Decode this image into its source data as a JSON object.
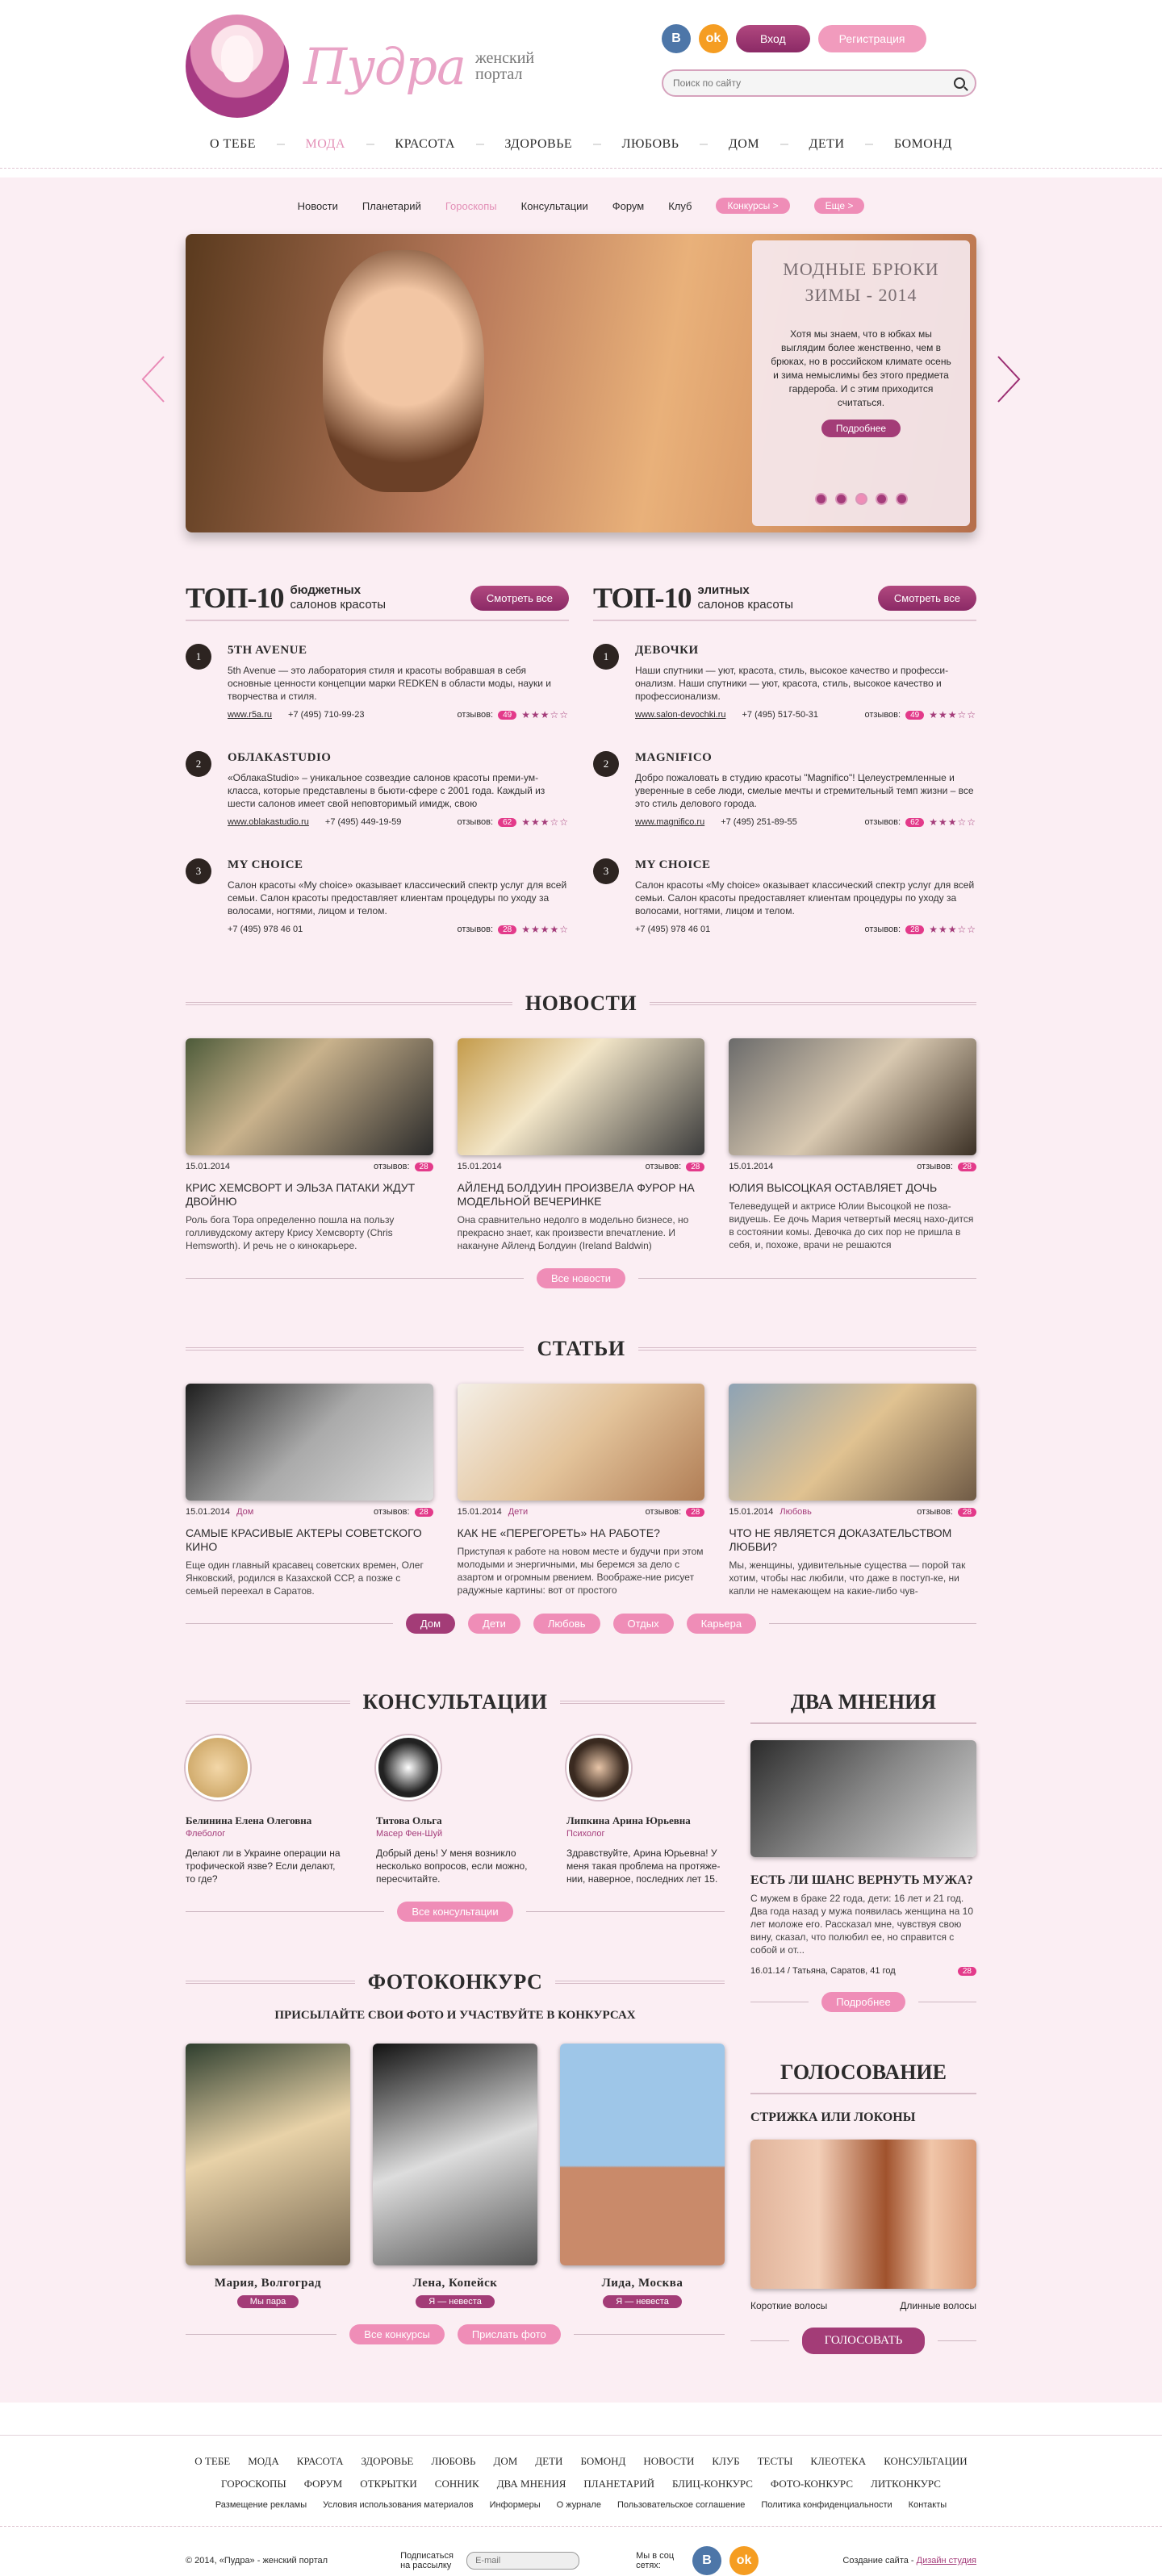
{
  "header": {
    "logo_word": "Пудра",
    "logo_sub1": "женский",
    "logo_sub2": "портал",
    "vk": "B",
    "ok": "ok",
    "login": "Вход",
    "register": "Регистрация",
    "search_placeholder": "Поиск по сайту"
  },
  "main_nav": [
    "О ТЕБЕ",
    "МОДА",
    "КРАСОТА",
    "ЗДОРОВЬЕ",
    "ЛЮБОВЬ",
    "ДОМ",
    "ДЕТИ",
    "БОМОНД"
  ],
  "main_nav_active": 1,
  "sub_nav": [
    "Новости",
    "Планетарий",
    "Гороскопы",
    "Консультации",
    "Форум",
    "Клуб"
  ],
  "sub_nav_active": 2,
  "sub_nav_pills": [
    "Конкурсы >",
    "Еще >"
  ],
  "slider": {
    "title": "МОДНЫЕ БРЮКИ ЗИМЫ - 2014",
    "text": "Хотя мы знаем, что в юбках мы выглядим более женственно, чем в брюках, но в российском климате осень и зима немыслимы без этого предмета гардероба. И с этим приходится считаться.",
    "button": "Подробнее",
    "dots": 5,
    "active_dot": 2
  },
  "top10": [
    {
      "title": "ТОП-10",
      "sub_bold": "бюджетных",
      "sub": "салонов красоты",
      "button": "Смотреть все",
      "items": [
        {
          "n": "1",
          "name": "5TH AVENUE",
          "desc": "5th Avenue — это лаборатория стиля и красоты вобравшая в себя основные ценности концепции марки REDKEN в области моды, науки и творчества и стиля.",
          "url": "www.r5a.ru",
          "phone": "+7 (495) 710-99-23",
          "reviews_label": "отзывов:",
          "reviews": "49",
          "stars": "★★★☆☆"
        },
        {
          "n": "2",
          "name": "ОБЛАКАSTUDIO",
          "desc": "«ОблакаStudio» – уникальное созвездие салонов красоты преми-ум-класса, которые представлены в бьюти-сфере с 2001 года. Каждый из шести салонов имеет свой неповторимый имидж, свою",
          "url": "www.oblakastudio.ru",
          "phone": "+7 (495) 449-19-59",
          "reviews_label": "отзывов:",
          "reviews": "62",
          "stars": "★★★☆☆"
        },
        {
          "n": "3",
          "name": "MY CHOICE",
          "desc": "Салон красоты «My choice» оказывает классический спектр услуг для всей семьи. Салон красоты предоставляет клиентам процедуры по уходу за волосами, ногтями, лицом и телом.",
          "url": "",
          "phone": "+7 (495) 978 46 01",
          "reviews_label": "отзывов:",
          "reviews": "28",
          "stars": "★★★★☆"
        }
      ]
    },
    {
      "title": "ТОП-10",
      "sub_bold": "элитных",
      "sub": "салонов красоты",
      "button": "Смотреть все",
      "items": [
        {
          "n": "1",
          "name": "ДЕВОЧКИ",
          "desc": "Наши спутники — уют, красота, стиль, высокое качество и професси-онализм. Наши спутники — уют, красота, стиль, высокое качество и профессионализм.",
          "url": "www.salon-devochki.ru",
          "phone": "+7 (495) 517-50-31",
          "reviews_label": "отзывов:",
          "reviews": "49",
          "stars": "★★★☆☆"
        },
        {
          "n": "2",
          "name": "MAGNIFICO",
          "desc": "Добро пожаловать в студию красоты \"Magnifico\"! Целеустремленные и уверенные в себе люди, смелые мечты и стремительный темп жизни – все это стиль делового города.",
          "url": "www.magnifico.ru",
          "phone": "+7 (495) 251-89-55",
          "reviews_label": "отзывов:",
          "reviews": "62",
          "stars": "★★★☆☆"
        },
        {
          "n": "3",
          "name": "MY CHOICE",
          "desc": "Салон красоты «My choice» оказывает классический спектр услуг для всей семьи. Салон красоты предоставляет клиентам процедуры по уходу за волосами, ногтями, лицом и телом.",
          "url": "",
          "phone": "+7 (495) 978 46 01",
          "reviews_label": "отзывов:",
          "reviews": "28",
          "stars": "★★★☆☆"
        }
      ]
    }
  ],
  "news": {
    "title": "НОВОСТИ",
    "more": "Все новости",
    "items": [
      {
        "date": "15.01.2014",
        "reviews_label": "отзывов:",
        "reviews": "28",
        "title": "КРИС ХЕМСВОРТ И ЭЛЬЗА ПАТАКИ ЖДУТ ДВОЙНЮ",
        "text": "Роль бога Тора определенно пошла на пользу голливудскому актеру Крису Хемсворту (Chris Hemsworth). И речь не о кинокарьере."
      },
      {
        "date": "15.01.2014",
        "reviews_label": "отзывов:",
        "reviews": "28",
        "title": "АЙЛЕНД БОЛДУИН ПРОИЗВЕЛА ФУРОР НА МОДЕЛЬНОЙ ВЕЧЕРИНКЕ",
        "text": "Она сравнительно недолго в модельно бизнесе, но прекрасно знает, как произвести впечатление. И накануне Айленд Болдуин (Ireland Baldwin)"
      },
      {
        "date": "15.01.2014",
        "reviews_label": "отзывов:",
        "reviews": "28",
        "title": "ЮЛИЯ ВЫСОЦКАЯ ОСТАВЛЯЕТ ДОЧЬ",
        "text": "Телеведущей и актрисе Юлии Высоцкой не поза-видуешь. Ее дочь Мария четвертый месяц нахо-дится в состоянии комы. Девочка до сих пор не пришла в себя, и, похоже, врачи не решаются"
      }
    ]
  },
  "articles": {
    "title": "СТАТЬИ",
    "tabs": [
      "Дом",
      "Дети",
      "Любовь",
      "Отдых",
      "Карьера"
    ],
    "tab_active": 0,
    "items": [
      {
        "date": "15.01.2014",
        "cat": "Дом",
        "reviews_label": "отзывов:",
        "reviews": "28",
        "title": "САМЫЕ КРАСИВЫЕ АКТЕРЫ СОВЕТСКОГО КИНО",
        "text": "Еще один главный красавец советских времен, Олег Янковский, родился в Казахской ССР, а позже с семьей переехал в Саратов."
      },
      {
        "date": "15.01.2014",
        "cat": "Дети",
        "reviews_label": "отзывов:",
        "reviews": "28",
        "title": "КАК НЕ «ПЕРЕГОРЕТЬ» НА РАБОТЕ?",
        "text": "Приступая к работе на новом месте и будучи при этом молодыми и энергичными, мы беремся за дело с азартом и огромным рвением. Воображе-ние рисует радужные картины: вот от простого"
      },
      {
        "date": "15.01.2014",
        "cat": "Любовь",
        "reviews_label": "отзывов:",
        "reviews": "28",
        "title": "ЧТО НЕ ЯВЛЯЕТСЯ ДОКАЗАТЕЛЬСТВОМ ЛЮБВИ?",
        "text": "Мы, женщины, удивительные существа — порой так хотим, чтобы нас любили, что даже в поступ-ке, ни капли не намекающем на какие-либо чув-"
      }
    ]
  },
  "consults": {
    "title": "КОНСУЛЬТАЦИИ",
    "more": "Все консультации",
    "items": [
      {
        "name": "Белинина Елена Олеговна",
        "role": "Флеболог",
        "text": "Делают ли в Украине операции на трофической язве? Если делают, то где?"
      },
      {
        "name": "Титова Ольга",
        "role": "Масер Фен-Шуй",
        "text": "Добрый день! У меня возникло несколько вопросов, если можно, пересчитайте."
      },
      {
        "name": "Липкина Арина Юрьевна",
        "role": "Психолог",
        "text": "Здравствуйте, Арина Юрьевна! У меня такая проблема на протяже-нии, наверное, последних лет 15."
      }
    ]
  },
  "contest": {
    "title": "ФОТОКОНКУРС",
    "subtitle": "ПРИСЫЛАЙТЕ СВОИ ФОТО И УЧАСТВУЙТЕ В КОНКУРСАХ",
    "items": [
      {
        "name": "Мария, Волгоград",
        "tag": "Мы пара"
      },
      {
        "name": "Лена, Копейск",
        "tag": "Я — невеста"
      },
      {
        "name": "Лида, Москва",
        "tag": "Я — невеста"
      }
    ],
    "btn_all": "Все конкурсы",
    "btn_send": "Прислать фото"
  },
  "opinions": {
    "title": "ДВА МНЕНИЯ",
    "question": "ЕСТЬ ЛИ ШАНС ВЕРНУТЬ МУЖА?",
    "text": "С мужем в браке 22 года, дети: 16 лет и 21 год. Два года назад у мужа появилась женщина на 10 лет моложе его. Рассказал мне, чувствуя свою вину, сказал, что полюбил ее, но справится с собой и от...",
    "meta": "16.01.14 / Татьяна, Саратов, 41 год",
    "reviews": "28",
    "button": "Подробнее"
  },
  "vote": {
    "title": "ГОЛОСОВАНИЕ",
    "question": "СТРИЖКА ИЛИ ЛОКОНЫ",
    "opt1": "Короткие волосы",
    "opt2": "Длинные волосы",
    "button": "ГОЛОСОВАТЬ"
  },
  "footer": {
    "nav1": [
      "О ТЕБЕ",
      "МОДА",
      "КРАСОТА",
      "ЗДОРОВЬЕ",
      "ЛЮБОВЬ",
      "ДОМ",
      "ДЕТИ",
      "БОМОНД",
      "НОВОСТИ",
      "КЛУБ",
      "ТЕСТЫ",
      "КЛЕОТЕКА",
      "КОНСУЛЬТАЦИИ"
    ],
    "nav2": [
      "ГОРОСКОПЫ",
      "ФОРУМ",
      "ОТКРЫТКИ",
      "СОННИК",
      "ДВА МНЕНИЯ",
      "ПЛАНЕТАРИЙ",
      "БЛИЦ-КОНКУРС",
      "ФОТО-КОНКУРС",
      "ЛИТКОНКУРС"
    ],
    "links": [
      "Размещение рекламы",
      "Условия использования материалов",
      "Информеры",
      "О журнале",
      "Пользовательское соглашение",
      "Политика конфиденциальности",
      "Контакты"
    ],
    "copyright": "© 2014, «Пудра» - женский портал",
    "sub_label": "Подписаться на рассылку",
    "email_placeholder": "E-mail",
    "soc_label": "Мы в соц сетях:",
    "created": "Создание сайта - ",
    "studio": "Дизайн студия"
  }
}
